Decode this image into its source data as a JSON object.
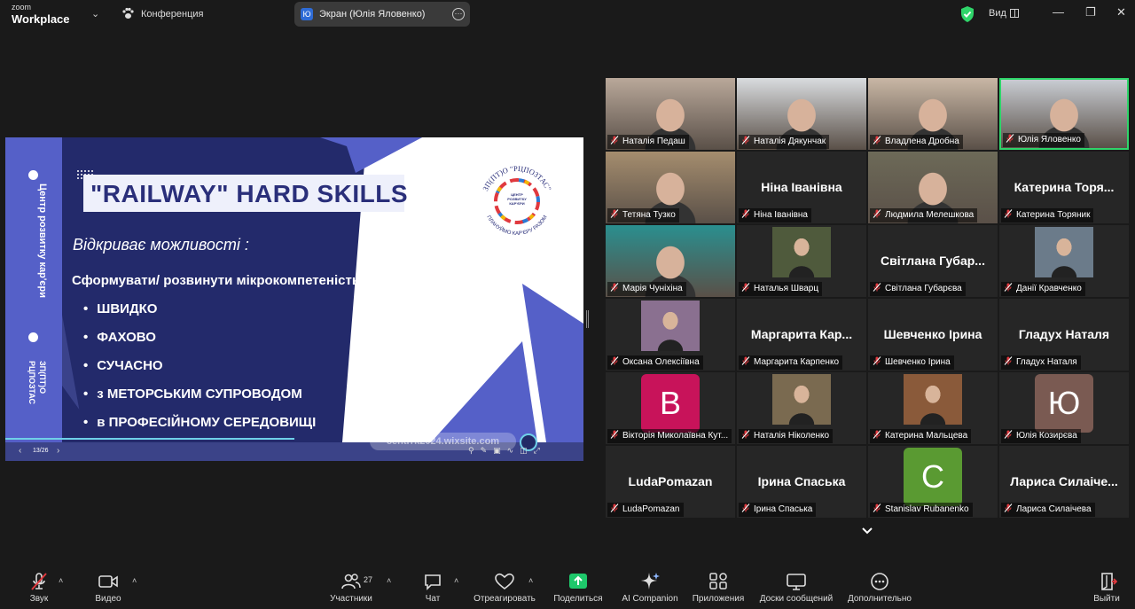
{
  "app": {
    "logo_line1": "zoom",
    "logo_line2": "Workplace",
    "meeting_title": "Конференция",
    "share_badge": "Ю",
    "share_title": "Экран (Юлія Яловенко)",
    "view_label": "Вид"
  },
  "slide": {
    "side_text": "Центр розвитку кар'єри",
    "side_org": "ЗП(ПТ)О РЦПОЗТАС",
    "title": "\"RAILWAY\" HARD SKILLS",
    "subtitle": "Відкриває можливості :",
    "lead": "Сформувати/ розвинути мікрокомпетеність",
    "bullets": [
      "ШВИДКО",
      "ФАХОВО",
      "СУЧАСНО",
      "з МЕТОРСЬКИМ СУПРОВОДОМ",
      "в ПРОФЕСІЙНОМУ СЕРЕДОВИЩІ"
    ],
    "emblem_top": "ЗП(ПТ)О \"РЦПОЗТАС\"",
    "emblem_bottom": "ПЛАНУЙМО КАР'ЄРУ РАЗОМ",
    "emblem_center": "ЦЕНТР РОЗВИТКУ КАР'ЄРИ",
    "page": "13/26",
    "progress": 0.5,
    "url": "centrrk2024.wixsite.com"
  },
  "participants": [
    {
      "name": "Наталія Педаш",
      "video": true,
      "bg": "#b9a89a"
    },
    {
      "name": "Наталія Дякунчак",
      "video": true,
      "bg": "#d9dcdf"
    },
    {
      "name": "Владлена Дробна",
      "video": true,
      "bg": "#c9b7a5"
    },
    {
      "name": "Юлія Яловенко",
      "video": true,
      "bg": "#c8ccd2",
      "active": true
    },
    {
      "name": "Тетяна Тузко",
      "video": true,
      "bg": "#a58d6e"
    },
    {
      "name": "Ніна Іванівна",
      "display": "Ніна Іванівна"
    },
    {
      "name": "Людмила Мелешкова",
      "video": true,
      "bg": "#6d6a58"
    },
    {
      "name": "Катерина Торяник",
      "display": "Катерина Торя..."
    },
    {
      "name": "Марія Чуніхіна",
      "video": true,
      "bg": "#2a8f8f"
    },
    {
      "name": "Наталья Шварц",
      "thumb": true,
      "bg": "#4f5a3c"
    },
    {
      "name": "Світлана Губарєва",
      "display": "Світлана Губар..."
    },
    {
      "name": "Данії Кравченко",
      "thumb": true,
      "bg": "#6b7b8a"
    },
    {
      "name": "Оксана Олексіївна",
      "thumb": true,
      "bg": "#8a7090"
    },
    {
      "name": "Маргарита Карпенко",
      "display": "Маргарита Кар..."
    },
    {
      "name": "Шевченко Ірина",
      "display": "Шевченко Ірина"
    },
    {
      "name": "Гладух Наталя",
      "display": "Гладух Наталя"
    },
    {
      "name": "Вікторія Миколаївна Кут...",
      "letter": "В",
      "bg": "#c8135a"
    },
    {
      "name": "Наталія Ніколенко",
      "thumb": true,
      "bg": "#7a6a50"
    },
    {
      "name": "Катерина Мальцева",
      "thumb": true,
      "bg": "#8a5a3a"
    },
    {
      "name": "Юлія Козирєва",
      "letter": "Ю",
      "bg": "#7a5a52"
    },
    {
      "name": "LudaPomazan",
      "display": "LudaPomazan"
    },
    {
      "name": "Ірина Спаська",
      "display": "Ірина Спаська"
    },
    {
      "name": "Stanislav Rubanenko",
      "letter": "С",
      "bg": "#5a9a32"
    },
    {
      "name": "Лариса Силаічева",
      "display": "Лариса Силаіче..."
    }
  ],
  "toolbar": {
    "sound": "Звук",
    "video": "Видео",
    "participants": "Участники",
    "participants_count": "27",
    "chat": "Чат",
    "react": "Отреагировать",
    "share": "Поделиться",
    "ai": "AI Companion",
    "apps": "Приложения",
    "whiteboards": "Доски сообщений",
    "more": "Дополнительно",
    "leave": "Выйти"
  },
  "colors": {
    "accent_green": "#2fd56a",
    "share_green": "#1ec86b",
    "mute_red": "#e0393e",
    "slide_navy": "#232a6b",
    "slide_blue": "#5560c8"
  }
}
